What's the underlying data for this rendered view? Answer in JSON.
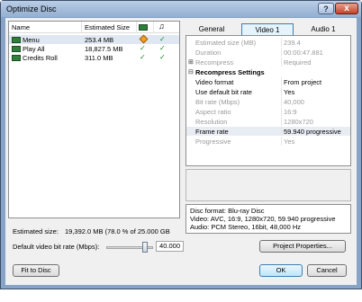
{
  "window": {
    "title": "Optimize Disc",
    "help": "?",
    "close": "x"
  },
  "list": {
    "headers": {
      "name": "Name",
      "size": "Estimated Size"
    },
    "rows": [
      {
        "name": "Menu",
        "size": "253.4 MB",
        "mark1": "◆",
        "mark2": "✓",
        "selected": true
      },
      {
        "name": "Play All",
        "size": "18,827.5 MB",
        "mark1": "✓",
        "mark2": "✓",
        "selected": false
      },
      {
        "name": "Credits Roll",
        "size": "311.0 MB",
        "mark1": "✓",
        "mark2": "✓",
        "selected": false
      }
    ]
  },
  "tabs": [
    {
      "label": "General",
      "active": false
    },
    {
      "label": "Video 1",
      "active": true
    },
    {
      "label": "Audio 1",
      "active": false
    }
  ],
  "properties": [
    {
      "key": "Estimated size (MB)",
      "value": "239.4",
      "enabled": false,
      "type": "item"
    },
    {
      "key": "Duration",
      "value": "00:00:47.881",
      "enabled": false,
      "type": "item"
    },
    {
      "key": "Recompress",
      "value": "Required",
      "enabled": false,
      "type": "expand",
      "mark": "⊞"
    },
    {
      "key": "Recompress Settings",
      "value": "",
      "enabled": true,
      "type": "section",
      "mark": "⊟"
    },
    {
      "key": "Video format",
      "value": "From project",
      "enabled": true,
      "type": "item"
    },
    {
      "key": "Use default bit rate",
      "value": "Yes",
      "enabled": true,
      "type": "item"
    },
    {
      "key": "Bit rate (Mbps)",
      "value": "40,000",
      "enabled": false,
      "type": "item"
    },
    {
      "key": "Aspect ratio",
      "value": "16:9",
      "enabled": false,
      "type": "item"
    },
    {
      "key": "Resolution",
      "value": "1280x720",
      "enabled": false,
      "type": "item"
    },
    {
      "key": "Frame rate",
      "value": "59.940 progressive",
      "enabled": true,
      "type": "item",
      "highlight": true
    },
    {
      "key": "Progressive",
      "value": "Yes",
      "enabled": false,
      "type": "item"
    }
  ],
  "info": {
    "line1": "Disc format:  Blu-ray Disc",
    "line2": "Video:  AVC, 16:9, 1280x720, 59.940 progressive",
    "line3": "Audio: PCM Stereo, 16bit, 48,000 Hz"
  },
  "estimate": {
    "label": "Estimated size:",
    "value": "19,392.0 MB   (78.0 % of 25.000 GB"
  },
  "bitrate": {
    "label": "Default video bit rate (Mbps):",
    "value": "40.000",
    "slider_fraction": 0.88
  },
  "buttons": {
    "project_properties": "Project Properties...",
    "fit_to_disc": "Fit to Disc",
    "ok": "OK",
    "cancel": "Cancel"
  },
  "icons": {
    "film_header": "film-icon",
    "music_header": "music-note-icon",
    "row": "movie-icon"
  }
}
